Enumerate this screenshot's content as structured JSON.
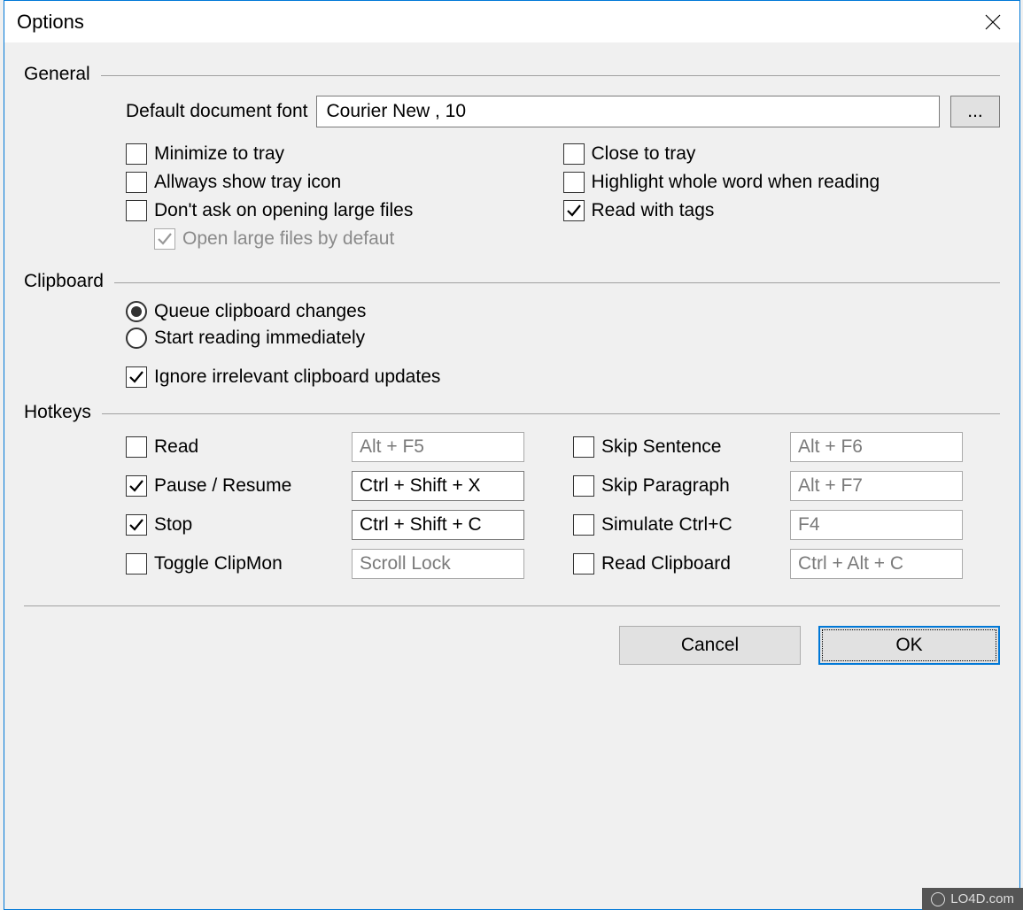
{
  "window": {
    "title": "Options"
  },
  "general": {
    "header": "General",
    "font_label": "Default document font",
    "font_value": "Courier New , 10",
    "browse_label": "...",
    "left_checks": [
      {
        "label": "Minimize to tray",
        "checked": false,
        "disabled": false
      },
      {
        "label": "Allways show tray icon",
        "checked": false,
        "disabled": false
      },
      {
        "label": "Don't ask on opening large files",
        "checked": false,
        "disabled": false
      },
      {
        "label": "Open large files by defaut",
        "checked": true,
        "disabled": true,
        "sub": true
      }
    ],
    "right_checks": [
      {
        "label": "Close to tray",
        "checked": false
      },
      {
        "label": "Highlight whole word when reading",
        "checked": false
      },
      {
        "label": "Read with tags",
        "checked": true
      }
    ]
  },
  "clipboard": {
    "header": "Clipboard",
    "radios": [
      {
        "label": "Queue clipboard changes",
        "selected": true
      },
      {
        "label": "Start reading immediately",
        "selected": false
      }
    ],
    "ignore_label": "Ignore irrelevant clipboard updates",
    "ignore_checked": true
  },
  "hotkeys": {
    "header": "Hotkeys",
    "left": [
      {
        "label": "Read",
        "checked": false,
        "value": "Alt + F5"
      },
      {
        "label": "Pause / Resume",
        "checked": true,
        "value": "Ctrl + Shift + X"
      },
      {
        "label": "Stop",
        "checked": true,
        "value": "Ctrl + Shift + C"
      },
      {
        "label": "Toggle ClipMon",
        "checked": false,
        "value": "Scroll Lock"
      }
    ],
    "right": [
      {
        "label": "Skip Sentence",
        "checked": false,
        "value": "Alt + F6"
      },
      {
        "label": "Skip Paragraph",
        "checked": false,
        "value": "Alt + F7"
      },
      {
        "label": "Simulate Ctrl+C",
        "checked": false,
        "value": "F4"
      },
      {
        "label": "Read Clipboard",
        "checked": false,
        "value": "Ctrl + Alt + C"
      }
    ]
  },
  "buttons": {
    "cancel": "Cancel",
    "ok": "OK"
  },
  "watermark": "LO4D.com"
}
